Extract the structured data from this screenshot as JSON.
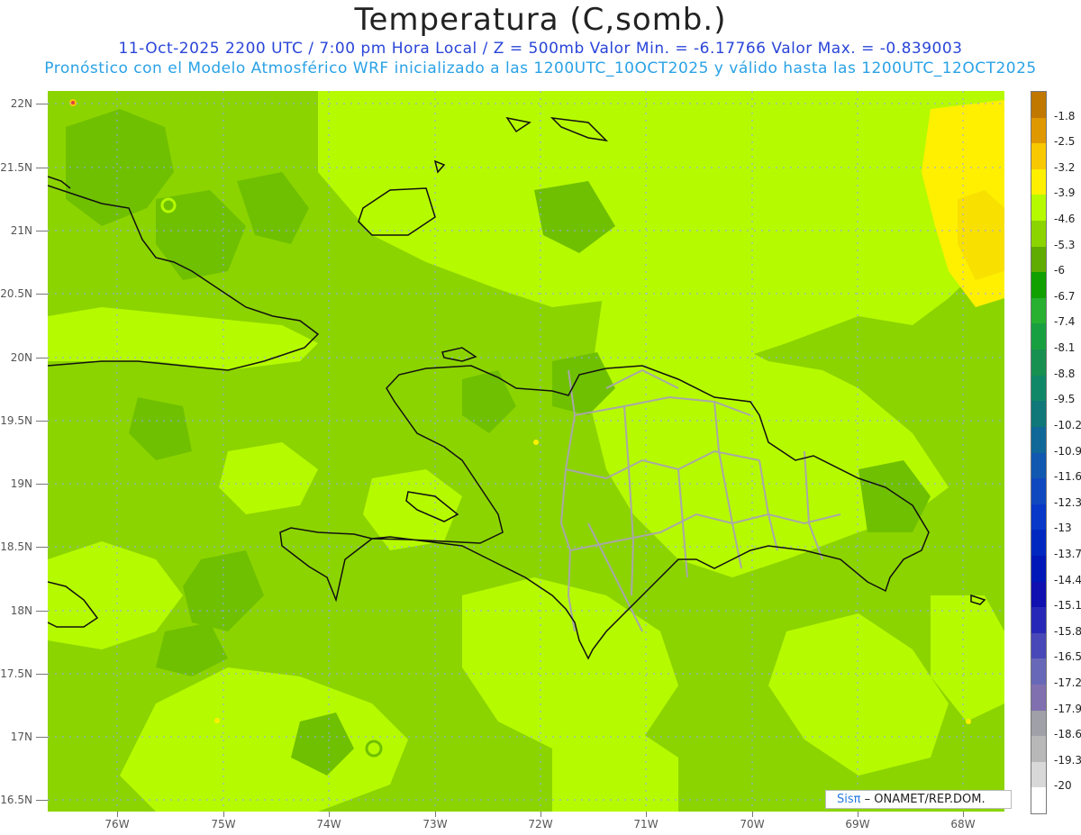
{
  "header": {
    "title": "Temperatura (C,somb.)",
    "subtitle_line1": "11-Oct-2025  2200 UTC / 7:00 pm Hora Local / Z = 500mb  Valor Min. = -6.17766  Valor Max. = -0.839003",
    "subtitle_line2": "Pronóstico con el Modelo Atmosférico WRF inicializado a las 1200UTC_10OCT2025 y válido hasta las  1200UTC_12OCT2025"
  },
  "axes": {
    "lat_labels": [
      "22N",
      "21.5N",
      "21N",
      "20.5N",
      "20N",
      "19.5N",
      "19N",
      "18.5N",
      "18N",
      "17.5N",
      "17N",
      "16.5N"
    ],
    "lon_labels": [
      "76W",
      "75W",
      "74W",
      "73W",
      "72W",
      "71W",
      "70W",
      "69W",
      "68W"
    ]
  },
  "colorbar": {
    "labels": [
      "-1.8",
      "-2.5",
      "-3.2",
      "-3.9",
      "-4.6",
      "-5.3",
      "-6",
      "-6.7",
      "-7.4",
      "-8.1",
      "-8.8",
      "-9.5",
      "-10.2",
      "-10.9",
      "-11.6",
      "-12.3",
      "-13",
      "-13.7",
      "-14.4",
      "-15.1",
      "-15.8",
      "-16.5",
      "-17.2",
      "-17.9",
      "-18.6",
      "-19.3",
      "-20"
    ],
    "colors": [
      "#c07800",
      "#e09800",
      "#f8c800",
      "#fff000",
      "#b6fa00",
      "#8cd400",
      "#60ac00",
      "#10a000",
      "#28b030",
      "#18a040",
      "#189050",
      "#108868",
      "#107878",
      "#106898",
      "#1058b0",
      "#1048c0",
      "#0838c8",
      "#0028c0",
      "#0018b8",
      "#1010b0",
      "#2828b8",
      "#4848b8",
      "#6868b8",
      "#8070b0",
      "#a0a0a8",
      "#b8b8b8",
      "#d8d8d8",
      "#ffffff"
    ]
  },
  "credit": {
    "brand": "Sisπ",
    "text": "– ONAMET/REP.DOM."
  }
}
